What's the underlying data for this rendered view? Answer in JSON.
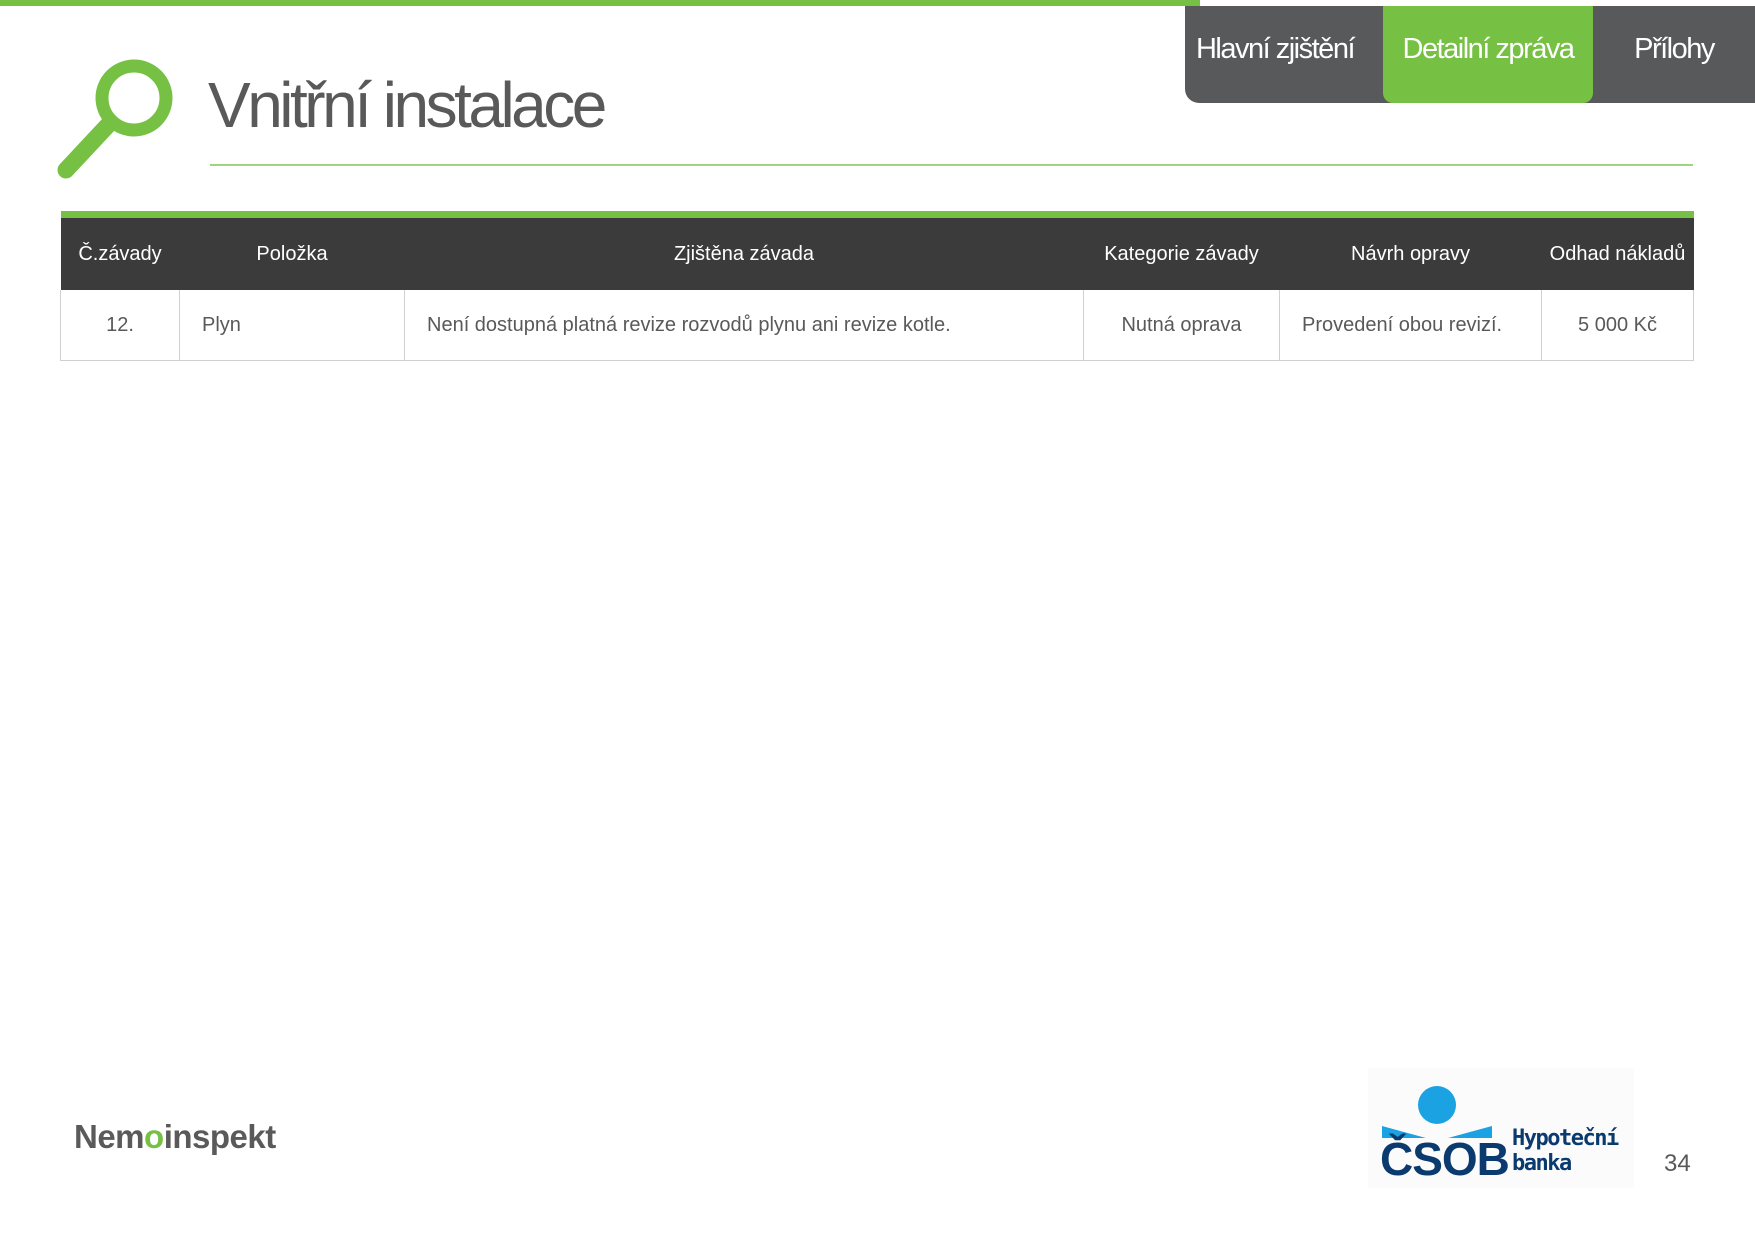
{
  "nav": {
    "tabs": [
      {
        "label": "Hlavní zjištění",
        "active": false
      },
      {
        "label": "Detailní zpráva",
        "active": true
      },
      {
        "label": "Přílohy",
        "active": false
      }
    ]
  },
  "header": {
    "title": "Vnitřní instalace",
    "icon": "search-icon"
  },
  "table": {
    "headers": [
      "Č.závady",
      "Položka",
      "Zjištěna závada",
      "Kategorie závady",
      "Návrh opravy",
      "Odhad nákladů"
    ],
    "rows": [
      [
        "12.",
        "Plyn",
        "Není dostupná platná revize rozvodů plynu ani revize kotle.",
        "Nutná oprava",
        "Provedení obou revizí.",
        "5 000 Kč"
      ]
    ]
  },
  "footer": {
    "left_logo": {
      "pre": "Nem",
      "mid": "o",
      "post": "inspekt"
    },
    "right_logo": {
      "brand": "ČSOB",
      "line1": "Hypoteční",
      "line2": "banka"
    },
    "page_number": "34"
  },
  "colors": {
    "accent": "#76c043",
    "dark": "#3b3b3b",
    "tab_bg": "#58595b",
    "text": "#595959",
    "csob_blue": "#1aa2e2",
    "csob_navy": "#0b3a6f"
  }
}
